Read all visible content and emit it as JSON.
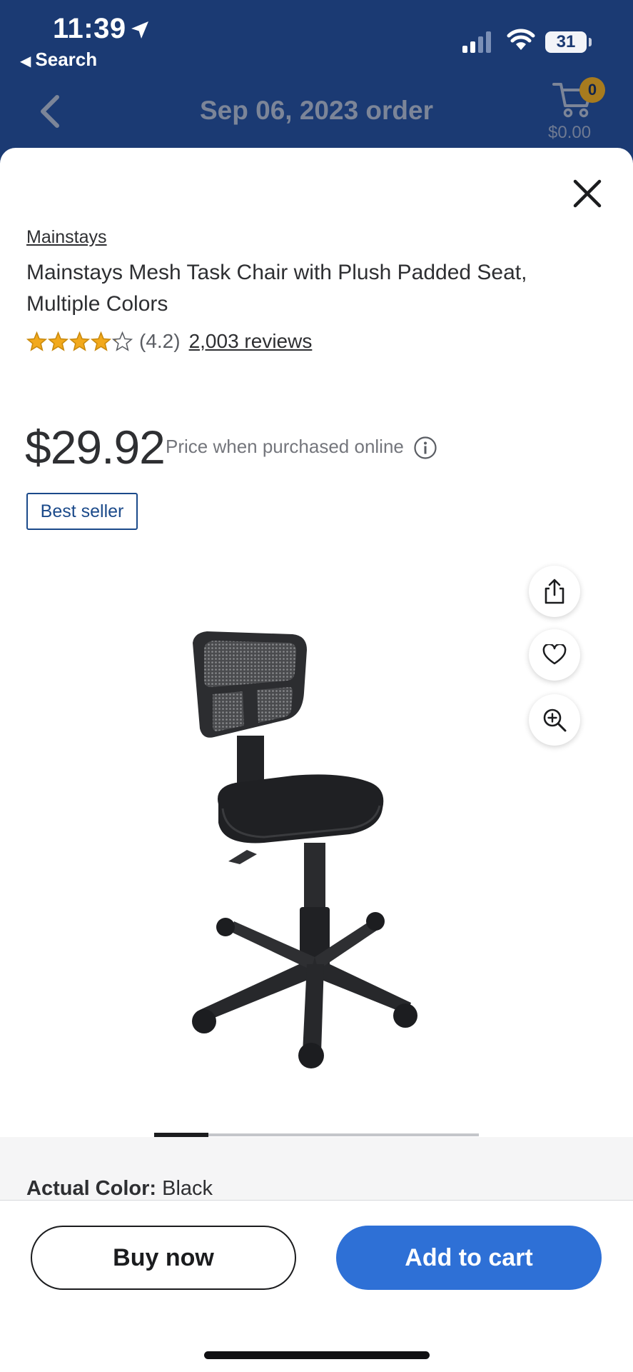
{
  "status_bar": {
    "time": "11:39",
    "back_app": "Search",
    "battery": "31"
  },
  "header": {
    "title": "Sep 06, 2023 order",
    "cart_count": "0",
    "cart_total": "$0.00"
  },
  "product": {
    "brand": "Mainstays",
    "title": "Mainstays Mesh Task Chair with Plush Padded Seat, Multiple Colors",
    "rating": 4.2,
    "rating_text": "(4.2)",
    "reviews": "2,003 reviews",
    "price": "$29.92",
    "price_note": "Price when purchased online",
    "badge": "Best seller",
    "color_label": "Actual Color:",
    "color_value": "Black",
    "carousel_position": 1
  },
  "actions": {
    "buy_now": "Buy now",
    "add_to_cart": "Add to cart"
  },
  "icons": {
    "share": "share-icon",
    "favorite": "heart-icon",
    "zoom": "zoom-in-icon",
    "close": "close-icon"
  },
  "colors": {
    "header_bg": "#1b3a73",
    "primary_blue": "#2e70d6",
    "star": "#f2a91c",
    "badge_border": "#1b4a8a"
  }
}
